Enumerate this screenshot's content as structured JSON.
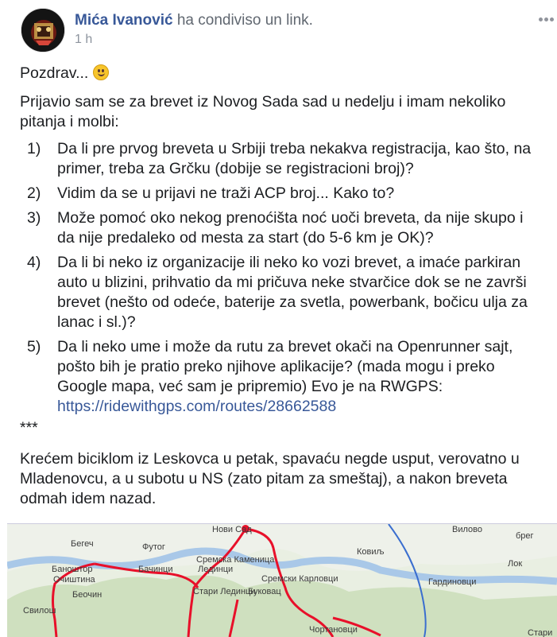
{
  "post": {
    "author": "Mića Ivanović",
    "action": "ha condiviso un link.",
    "timestamp": "1 h",
    "greeting": "Pozdrav...",
    "intro": "Prijavio sam se za brevet iz Novog Sada sad u nedelju i imam nekoliko pitanja i molbi:",
    "questions": [
      {
        "num": "1)",
        "text": "Da li pre prvog breveta u Srbiji treba nekakva registracija, kao što, na primer, treba za Grčku (dobije se registracioni broj)?"
      },
      {
        "num": "2)",
        "text": "Vidim da se u prijavi ne traži ACP broj... Kako to?"
      },
      {
        "num": "3)",
        "text": "Može pomoć oko nekog prenoćišta noć uoči breveta, da nije skupo i da nije predaleko od mesta za start (do 5-6 km je OK)?"
      },
      {
        "num": "4)",
        "text": "Da li bi neko iz organizacije ili neko ko vozi brevet, a imaće parkiran auto u blizini, prihvatio da mi pričuva neke stvarčice dok se ne završi brevet (nešto od odeće, baterije za svetla, powerbank, bočicu ulja za lanac i sl.)?"
      },
      {
        "num": "5)",
        "text": "Da li neko ume i može da rutu za brevet okači na Openrunner sajt, pošto bih je pratio preko njihove aplikacije? (mada mogu i preko Google mapa, već sam je pripremio) Evo je na RWGPS:",
        "link": "https://ridewithgps.com/routes/28662588"
      }
    ],
    "separator": "***",
    "closing": "Krećem biciklom iz Leskovca u petak, spavaću negde usput, verovatno u Mladenovcu, a u subotu u NS (zato pitam za smeštaj), a nakon breveta odmah idem nazad."
  },
  "map": {
    "labels": [
      "Нови Сад",
      "Вилово",
      "Бегеч",
      "Футог",
      "Ковиљ",
      "брег",
      "Сремска Каменица",
      "Бачинци",
      "Лединци",
      "Сремски Карловци",
      "Лок",
      "Баноштор",
      "Очиштина",
      "Беочин",
      "Стари Лединци",
      "Буковац",
      "Гардиновци",
      "Свилош",
      "Чортановци",
      "Стари"
    ],
    "route_color": "#e8102a"
  },
  "icons": {
    "more": "more-options-icon",
    "emoji": "smiley-emoji-icon"
  }
}
